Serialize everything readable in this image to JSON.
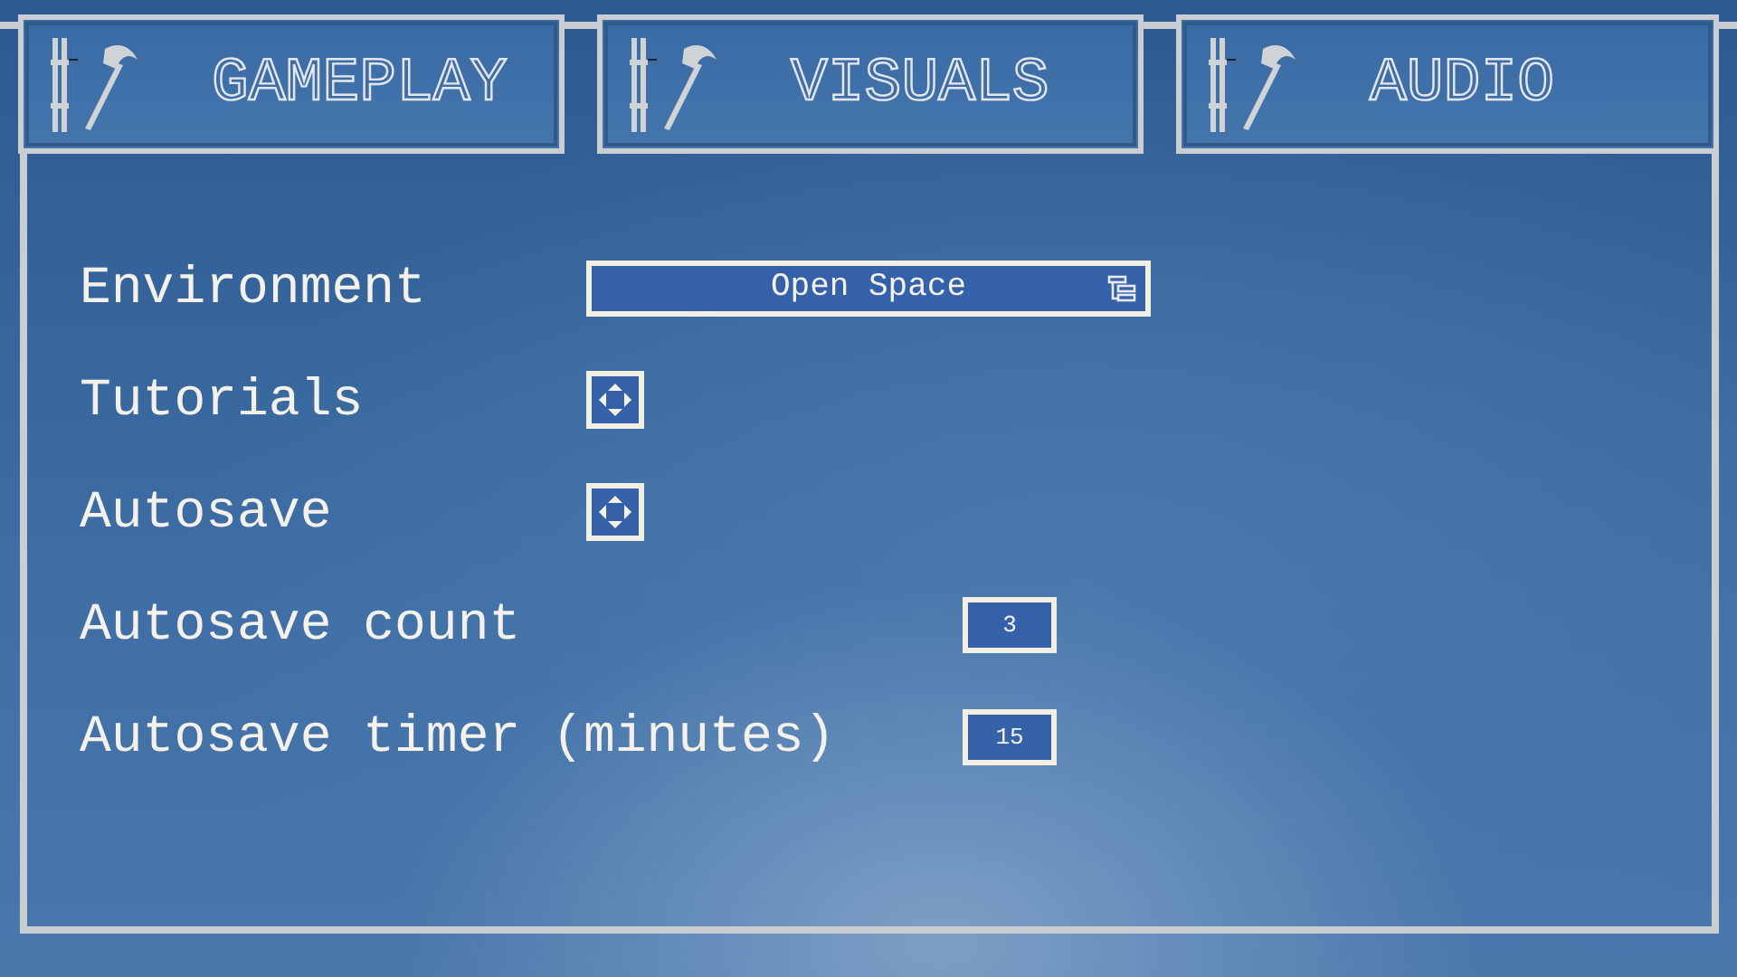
{
  "tabs": [
    {
      "label": "GAMEPLAY"
    },
    {
      "label": "VISUALS"
    },
    {
      "label": "AUDIO"
    }
  ],
  "settings": [
    {
      "kind": "dropdown",
      "label": "Environment",
      "value": "Open Space"
    },
    {
      "kind": "checkbox",
      "label": "Tutorials",
      "checked": true
    },
    {
      "kind": "checkbox",
      "label": "Autosave",
      "checked": true
    },
    {
      "kind": "number",
      "label": "Autosave count",
      "value": "3"
    },
    {
      "kind": "number",
      "label": "Autosave timer (minutes)",
      "value": "15"
    }
  ]
}
